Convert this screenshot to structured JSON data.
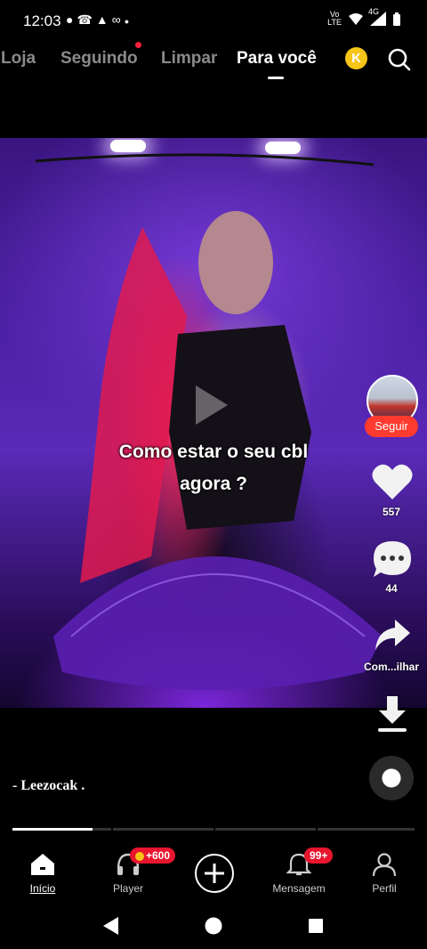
{
  "status_bar": {
    "time": "12:03",
    "notification_icons": [
      "chat-bubble-icon",
      "missed-call-icon",
      "android-icon",
      "voicemail-icon",
      "dot-icon"
    ],
    "volte_line1": "Vo",
    "volte_line2": "LTE",
    "network": "4G",
    "system_icons": [
      "volte-icon",
      "wifi-icon",
      "signal-icon",
      "battery-icon"
    ]
  },
  "top_nav": {
    "tabs": [
      {
        "label": "Loja",
        "active": false
      },
      {
        "label": "Seguindo",
        "active": false,
        "has_dot": true
      },
      {
        "label": "Limpar",
        "active": false
      },
      {
        "label": "Para você",
        "active": true
      }
    ],
    "coin_label": "K",
    "search_icon": "search-icon"
  },
  "video": {
    "caption_line1": "Como estar o seu cbl",
    "caption_line2": "agora ?"
  },
  "right_rail": {
    "follow_label": "Seguir",
    "likes": "557",
    "comments": "44",
    "share_label": "Com...ilhar"
  },
  "post": {
    "username": "- Leezocak  ."
  },
  "progress": {
    "fraction": 0.2
  },
  "tab_bar": {
    "items": [
      {
        "label": "Início",
        "icon": "home-icon",
        "active": true
      },
      {
        "label": "Player",
        "icon": "headphones-icon",
        "badge": "+600"
      },
      {
        "label": "",
        "icon": "plus-icon"
      },
      {
        "label": "Mensagem",
        "icon": "bell-icon",
        "badge": "99+"
      },
      {
        "label": "Perfil",
        "icon": "person-icon"
      }
    ]
  },
  "system_nav": [
    "back-icon",
    "home-circle-icon",
    "recents-icon"
  ],
  "colors": {
    "accent_red": "#ff3b2f",
    "badge_red": "#e8152e",
    "coin_yellow": "#f5c518",
    "background": "#000000"
  }
}
